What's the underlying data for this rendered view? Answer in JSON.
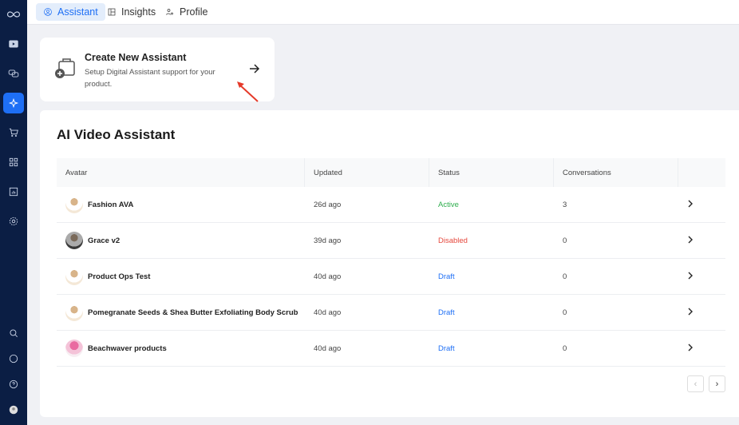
{
  "tabs": [
    {
      "label": "Assistant"
    },
    {
      "label": "Insights"
    },
    {
      "label": "Profile"
    }
  ],
  "create_card": {
    "title": "Create New Assistant",
    "description": "Setup Digital Assistant support for your product."
  },
  "section_title": "AI Video Assistant",
  "table": {
    "headers": [
      "Avatar",
      "Updated",
      "Status",
      "Conversations"
    ],
    "rows": [
      {
        "name": "Fashion AVA",
        "updated": "26d ago",
        "status": "Active",
        "conversations": "3"
      },
      {
        "name": "Grace v2",
        "updated": "39d ago",
        "status": "Disabled",
        "conversations": "0"
      },
      {
        "name": "Product Ops Test",
        "updated": "40d ago",
        "status": "Draft",
        "conversations": "0"
      },
      {
        "name": "Pomegranate Seeds & Shea Butter Exfoliating Body Scrub",
        "updated": "40d ago",
        "status": "Draft",
        "conversations": "0"
      },
      {
        "name": "Beachwaver products",
        "updated": "40d ago",
        "status": "Draft",
        "conversations": "0"
      }
    ]
  },
  "colors": {
    "active": "#2fae4e",
    "disabled": "#e5483d",
    "draft": "#1e6ff5",
    "accent": "#1e6ff5",
    "sidebar": "#0b1e44"
  }
}
